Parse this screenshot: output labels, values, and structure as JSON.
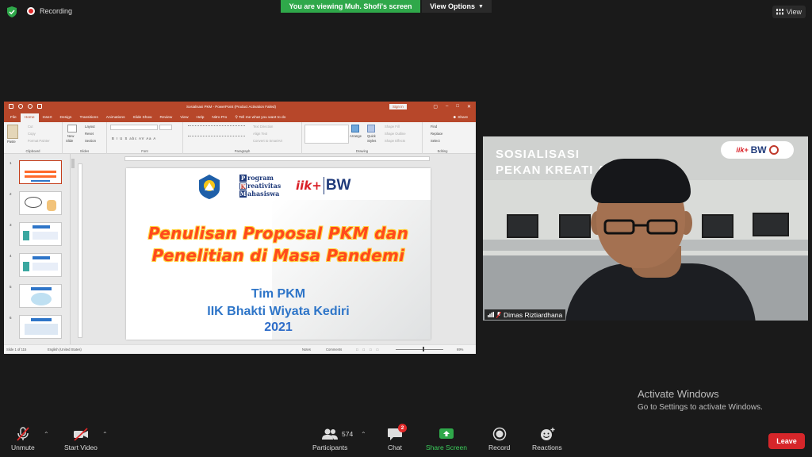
{
  "meeting": {
    "recording_label": "Recording",
    "share_banner": "You are viewing Muh. Shofi's screen",
    "view_options_label": "View Options",
    "view_label": "View"
  },
  "ppt": {
    "window_title": "Sosialisasi PKM - PowerPoint (Product Activation Failed)",
    "sign_in": "Sign in",
    "tabs": [
      "File",
      "Home",
      "Insert",
      "Design",
      "Transitions",
      "Animations",
      "Slide Show",
      "Review",
      "View",
      "Help",
      "Nitro Pro"
    ],
    "active_tab": "Home",
    "tell_me": "Tell me what you want to do",
    "share": "Share",
    "ribbon": {
      "paste": "Paste",
      "cut": "Cut",
      "copy": "Copy",
      "format_painter": "Format Painter",
      "clipboard": "Clipboard",
      "new_slide_1": "New",
      "new_slide_2": "Slide",
      "layout": "Layout",
      "reset": "Reset",
      "section": "Section",
      "slides": "Slides",
      "font_group": "Font",
      "font_buttons": "B  I  U  S  abc  AV  Aa  A",
      "text_direction": "Text Direction",
      "align_text": "Align Text",
      "convert_smartart": "Convert to SmartArt",
      "paragraph": "Paragraph",
      "arrange": "Arrange",
      "quick_styles_1": "Quick",
      "quick_styles_2": "Styles",
      "shape_fill": "Shape Fill",
      "shape_outline": "Shape Outline",
      "shape_effects": "Shape Effects",
      "drawing": "Drawing",
      "find": "Find",
      "replace": "Replace",
      "select": "Select",
      "editing": "Editing"
    },
    "thumbnails": [
      "1",
      "2",
      "3",
      "4",
      "5",
      "6"
    ],
    "slide": {
      "pkm_p": "P",
      "pkm_rogram": "rogram",
      "pkm_k": "K",
      "pkm_reativitas": "reativitas",
      "pkm_m": "M",
      "pkm_ahasiswa": "ahasiswa",
      "iik": "iik+",
      "bw": "BW",
      "title_line1": "Penulisan Proposal PKM dan",
      "title_line2": "Penelitian di Masa Pandemi",
      "sub_line1": "Tim PKM",
      "sub_line2": "IIK Bhakti Wiyata Kediri",
      "sub_line3": "2021"
    },
    "status": {
      "slide_of": "Slide 1 of 115",
      "language": "English (United States)",
      "notes": "Notes",
      "comments": "Comments",
      "zoom": "69%"
    }
  },
  "video": {
    "banner_line1": "SOSIALISASI",
    "banner_line2": "PEKAN KREATI         ASISWA",
    "badge_iik": "iik+",
    "badge_bw": "BW",
    "participant_name": "Dimas Riztiardhana"
  },
  "activation": {
    "line1": "Activate Windows",
    "line2": "Go to Settings to activate Windows."
  },
  "toolbar": {
    "unmute": "Unmute",
    "start_video": "Start Video",
    "participants": "Participants",
    "participant_count": "574",
    "chat": "Chat",
    "chat_badge": "2",
    "share_screen": "Share Screen",
    "record": "Record",
    "reactions": "Reactions",
    "leave": "Leave"
  },
  "colors": {
    "ppt_accent": "#b7472a",
    "share_green": "#2fa84a",
    "leave_red": "#d6262a",
    "slide_title_orange": "#ff4a1c",
    "slide_sub_blue": "#2e75c8"
  }
}
